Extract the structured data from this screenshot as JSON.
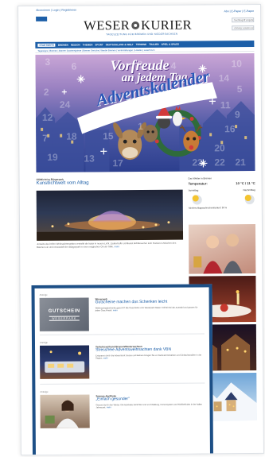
{
  "header": {
    "top_left": "Abonnieren | Login | Registrieren",
    "top_right": "Abo | E-Paper | E-Paper",
    "logo_left": "WESER",
    "logo_right": "KURIER",
    "slogan": "TAGESZEITUNG FÜR BREMEN UND NIEDERSACHSEN",
    "search_placeholder": "Suchbegriff eingeben",
    "location_select": "Zeitung: Lokales wählen"
  },
  "nav": {
    "items": [
      "STARTSEITE",
      "BREMEN",
      "REGION",
      "THEMEN",
      "SPORT",
      "DEUTSCHLAND & WELT",
      "TERMINE",
      "TRAUER",
      "SPIEL & SPASS"
    ],
    "active_index": 0
  },
  "subnav": "Tagestipps | Bremen | Bremer Sportereignisse | Bremer Gerüche | Werder Bremen | Veranstaltungen | Lokales | Leserforum",
  "banner": {
    "line1": "Vorfreude",
    "line2": "an jedem Tag",
    "script": "Adventskalender",
    "numbers": [
      "3",
      "6",
      "8",
      "10",
      "14",
      "5",
      "2",
      "24",
      "12",
      "11",
      "9",
      "16",
      "7",
      "18",
      "15",
      "1",
      "13",
      "19",
      "17",
      "20",
      "23",
      "22",
      "21",
      "4"
    ]
  },
  "lead": {
    "kicker": "Glühlicht im Bürgerpark",
    "headline": "Kunstlichtwelt vom Alltag",
    "text": "Jenseits des hellen Weihnachtsmarktes erstrahlt die Natur in neuem Licht. Zauberhafte Lichtkunst lädt Besucher zum Flanieren zwischen den Bäumen ein und verwandelt den Bürgerpark in einen magischen Ort der Stille.",
    "more": "mehr"
  },
  "weather": {
    "title": "Das Wetter in Bremen",
    "temp_label": "Temperatur:",
    "temp_value": "10 °C / 11 °C",
    "day1": "Vormittag",
    "day2": "Nachmittag",
    "precip": "Niederschlagswahrscheinlichkeit: 30 %"
  },
  "cards": [
    {
      "label": "Anzeige",
      "kicker": "Weserpark",
      "headline": "Gutscheine machen das Schenken leicht",
      "text": "Weihnachtsgeschenke gesucht? Die Gutscheine vom Weserpark bieten Freiheit bei der Auswahl und passen für jeden Geschmack.",
      "more": "mehr",
      "voucher_title": "GUTSCHEIN",
      "voucher_brand": "WESERPARK"
    },
    {
      "label": "Anzeige",
      "kicker": "Verkehrsverbund Bremen/Niedersachsen",
      "headline": "Stressfreie Adventsweihnachten dank VBN",
      "text": "Entspannt durch die Adventszeit: Busse und Bahnen bringen Sie zu Weihnachtsmärkten und Einkaufsstraßen in der Region.",
      "more": "mehr"
    },
    {
      "label": "Anzeige",
      "kicker": "Sonnen-Apotheke",
      "headline": "„Einfach gesünder\"",
      "text": "Gesund durch den Winter: Die Apotheke berät Sie rund um Erkältung, Immunsystem und Wohlbefinden in der kalten Jahreszeit.",
      "more": "mehr"
    }
  ],
  "colors": {
    "brand": "#1d5fa8",
    "frame": "#1d4f86",
    "banner_top": "#c9a6d6",
    "banner_bottom": "#2c3f8e"
  }
}
